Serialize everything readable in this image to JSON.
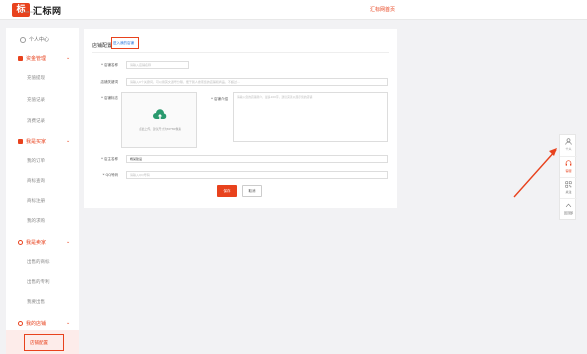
{
  "header": {
    "logo_badge": "标",
    "logo_text": "汇标网",
    "logo_sub": "HUIBIAO",
    "home_link": "汇标网首页"
  },
  "sidebar": {
    "personal": "个人中心",
    "groups": [
      {
        "label": "资金管理",
        "items": [
          "充值提现",
          "充值记录",
          "消费记录"
        ]
      },
      {
        "label": "我是买家",
        "items": [
          "我的订单",
          "商标查询",
          "商标注册",
          "我的求购"
        ]
      },
      {
        "label": "我是卖家",
        "items": [
          "出售的商标",
          "出售的专利",
          "我要出售"
        ]
      },
      {
        "label": "我的店铺",
        "items": [
          "店铺配置"
        ]
      }
    ],
    "active_item": "店铺配置"
  },
  "content": {
    "title": "店铺配置",
    "link": "进入我的店铺",
    "fields": {
      "shop_name": {
        "label": "* 店铺名称",
        "placeholder": "请输入店铺名称"
      },
      "seo_keywords": {
        "label": "店铺关键词",
        "placeholder": "请输入0个关键词，可以用英文逗号分隔，便于别人搜索您的店铺和商品，不超过..."
      },
      "logo": {
        "label": "* 店铺标志",
        "upload_text": "点此上传，建议尺寸为80*80像素"
      },
      "intro": {
        "label": "* 店铺介绍",
        "placeholder": "请输入您的店铺简介，最多100字，建议完善以展示您的店铺"
      },
      "owner": {
        "label": "* 店主名称",
        "value": "杨某建设"
      },
      "qq": {
        "label": "* QQ号码",
        "placeholder": "请输入QQ号码"
      }
    },
    "save_button": "保存",
    "cancel_button": "取消"
  },
  "rightbar": {
    "items": [
      {
        "icon": "person-icon",
        "label": "个人"
      },
      {
        "icon": "headset-icon",
        "label": "客服"
      },
      {
        "icon": "qrcode-icon",
        "label": "关注"
      },
      {
        "icon": "arrow-up-icon",
        "label": "回顶部"
      }
    ]
  },
  "colors": {
    "accent": "#e8421d",
    "link": "#1e6fd9"
  }
}
